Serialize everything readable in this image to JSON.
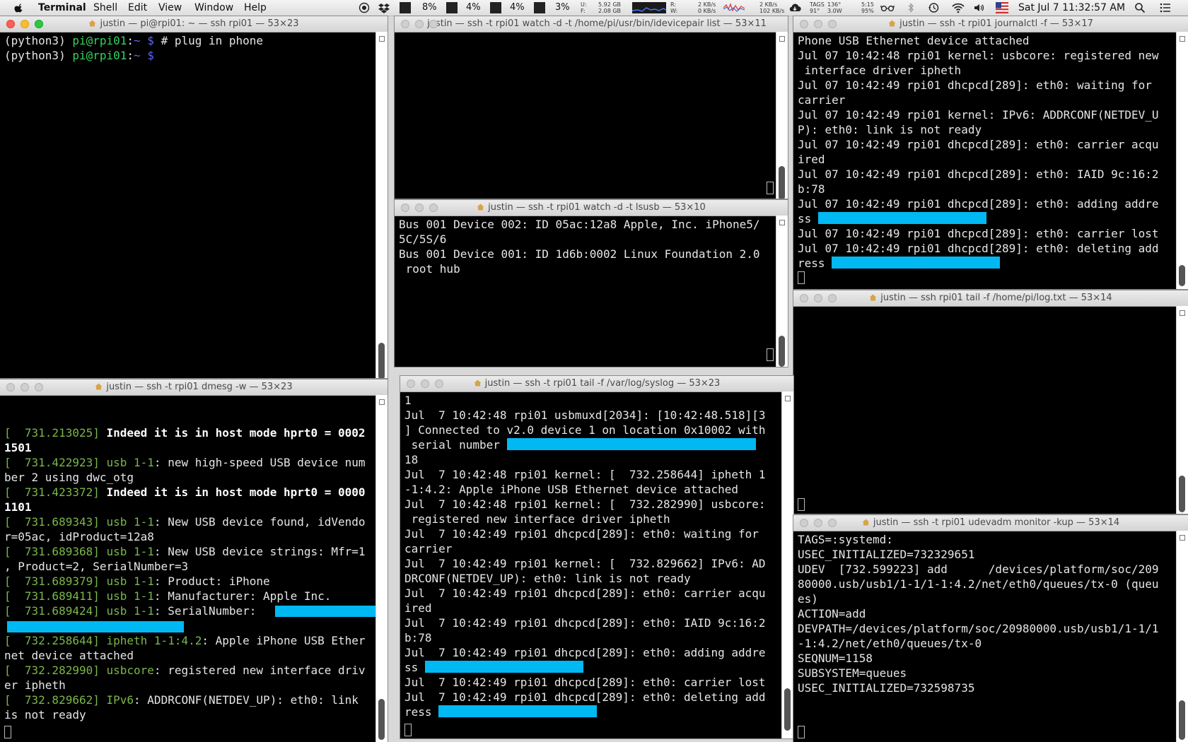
{
  "menubar": {
    "app": "Terminal",
    "menus": [
      "Shell",
      "Edit",
      "View",
      "Window",
      "Help"
    ],
    "cpu": [
      "8%",
      "4%",
      "4%",
      "3%"
    ],
    "mem_u": "U:",
    "mem_f": "F:",
    "mem_u_val": "5.92 GB",
    "mem_f_val": "2.08 GB",
    "disk_r": "R:",
    "disk_w": "W:",
    "disk_r_val": "2 KB/s",
    "disk_w_val": "0 KB/s",
    "net_up": "2 KB/s",
    "net_down": "102 KB/s",
    "sens1": "TAGS",
    "sens2": "91°",
    "sens3": "136°",
    "sens4": "3.0W",
    "bat1": "5:15",
    "bat2": "95%",
    "clock": "Sat Jul 7  11:32:57 AM"
  },
  "windows": {
    "w1": {
      "title": "justin — pi@rpi01: ~ — ssh rpi01 — 53×23",
      "prompt1_env": "(python3) ",
      "prompt1_user": "pi@rpi01",
      "prompt1_sep": ":",
      "prompt1_dir": "~",
      "prompt1_sym": " $",
      "prompt1_cmd": " # plug in phone",
      "prompt2_env": "(python3) ",
      "prompt2_user": "pi@rpi01",
      "prompt2_sep": ":",
      "prompt2_dir": "~",
      "prompt2_sym": " $"
    },
    "w2": {
      "title": "justin — ssh -t rpi01 watch -d -t /home/pi/usr/bin/idevicepair list — 53×11"
    },
    "w3": {
      "title": "justin — ssh -t rpi01 watch -d -t lsusb — 53×10",
      "lines": [
        "Bus 001 Device 002: ID 05ac:12a8 Apple, Inc. iPhone5/",
        "5C/5S/6",
        "Bus 001 Device 001: ID 1d6b:0002 Linux Foundation 2.0",
        " root hub"
      ]
    },
    "w4": {
      "title": "justin — ssh -t rpi01 journalctl -f — 53×17",
      "lines": [
        "Phone USB Ethernet device attached",
        "Jul 07 10:42:48 rpi01 kernel: usbcore: registered new",
        " interface driver ipheth",
        "Jul 07 10:42:49 rpi01 dhcpcd[289]: eth0: waiting for",
        "carrier",
        "Jul 07 10:42:49 rpi01 kernel: IPv6: ADDRCONF(NETDEV_U",
        "P): eth0: link is not ready",
        "Jul 07 10:42:49 rpi01 dhcpcd[289]: eth0: carrier acqu",
        "ired",
        "Jul 07 10:42:49 rpi01 dhcpcd[289]: eth0: IAID 9c:16:2",
        "b:78",
        "Jul 07 10:42:49 rpi01 dhcpcd[289]: eth0: adding addre",
        "ss ",
        "Jul 07 10:42:49 rpi01 dhcpcd[289]: eth0: carrier lost",
        "Jul 07 10:42:49 rpi01 dhcpcd[289]: eth0: deleting add",
        "ress "
      ]
    },
    "w5": {
      "title": "justin — ssh rpi01 tail -f /home/pi/log.txt — 53×14"
    },
    "w6": {
      "title": "justin — ssh -t rpi01 dmesg -w — 53×23",
      "lines": [
        {
          "ts": "[  731.213025]",
          "src": " ",
          "msg": "Indeed it is in host mode hprt0 = 0002",
          "bold": true
        },
        {
          "ts": "",
          "src": "",
          "msg": "1501",
          "bold": true
        },
        {
          "ts": "[  731.422923]",
          "src": " usb 1-1",
          "msg": ": new high-speed USB device num",
          "bold": false
        },
        {
          "ts": "",
          "src": "",
          "msg": "ber 2 using dwc_otg",
          "bold": false
        },
        {
          "ts": "[  731.423372]",
          "src": " ",
          "msg": "Indeed it is in host mode hprt0 = 0000",
          "bold": true
        },
        {
          "ts": "",
          "src": "",
          "msg": "1101",
          "bold": true
        },
        {
          "ts": "[  731.689343]",
          "src": " usb 1-1",
          "msg": ": New USB device found, idVendo",
          "bold": false
        },
        {
          "ts": "",
          "src": "",
          "msg": "r=05ac, idProduct=12a8",
          "bold": false
        },
        {
          "ts": "[  731.689368]",
          "src": " usb 1-1",
          "msg": ": New USB device strings: Mfr=1",
          "bold": false
        },
        {
          "ts": "",
          "src": "",
          "msg": ", Product=2, SerialNumber=3",
          "bold": false
        },
        {
          "ts": "[  731.689379]",
          "src": " usb 1-1",
          "msg": ": Product: iPhone",
          "bold": false
        },
        {
          "ts": "[  731.689411]",
          "src": " usb 1-1",
          "msg": ": Manufacturer: Apple Inc.",
          "bold": false
        },
        {
          "ts": "[  731.689424]",
          "src": " usb 1-1",
          "msg": ": SerialNumber: ",
          "bold": false
        },
        {
          "ts": "",
          "src": "",
          "msg": "",
          "bold": false
        },
        {
          "ts": "[  732.258644]",
          "src": " ipheth 1-1:4.2",
          "msg": ": Apple iPhone USB Ether",
          "bold": false
        },
        {
          "ts": "",
          "src": "",
          "msg": "net device attached",
          "bold": false
        },
        {
          "ts": "[  732.282990]",
          "src": " usbcore",
          "msg": ": registered new interface driv",
          "bold": false
        },
        {
          "ts": "",
          "src": "",
          "msg": "er ipheth",
          "bold": false
        },
        {
          "ts": "[  732.829662]",
          "src": " IPv6",
          "msg": ": ADDRCONF(NETDEV_UP): eth0: link",
          "bold": false
        },
        {
          "ts": "",
          "src": "",
          "msg": "is not ready",
          "bold": false
        }
      ]
    },
    "w7": {
      "title": "justin — ssh -t rpi01 tail -f /var/log/syslog — 53×23",
      "lines": [
        "1",
        "Jul  7 10:42:48 rpi01 usbmuxd[2034]: [10:42:48.518][3",
        "] Connected to v2.0 device 1 on location 0x10002 with",
        " serial number ",
        "18",
        "Jul  7 10:42:48 rpi01 kernel: [  732.258644] ipheth 1",
        "-1:4.2: Apple iPhone USB Ethernet device attached",
        "Jul  7 10:42:48 rpi01 kernel: [  732.282990] usbcore:",
        " registered new interface driver ipheth",
        "Jul  7 10:42:49 rpi01 dhcpcd[289]: eth0: waiting for",
        "carrier",
        "Jul  7 10:42:49 rpi01 kernel: [  732.829662] IPv6: AD",
        "DRCONF(NETDEV_UP): eth0: link is not ready",
        "Jul  7 10:42:49 rpi01 dhcpcd[289]: eth0: carrier acqu",
        "ired",
        "Jul  7 10:42:49 rpi01 dhcpcd[289]: eth0: IAID 9c:16:2",
        "b:78",
        "Jul  7 10:42:49 rpi01 dhcpcd[289]: eth0: adding addre",
        "ss ",
        "Jul  7 10:42:49 rpi01 dhcpcd[289]: eth0: carrier lost",
        "Jul  7 10:42:49 rpi01 dhcpcd[289]: eth0: deleting add",
        "ress "
      ]
    },
    "w8": {
      "title": "justin — ssh -t rpi01 udevadm monitor -kup — 53×14",
      "lines": [
        "TAGS=:systemd:",
        "USEC_INITIALIZED=732329651",
        "",
        "UDEV  [732.599223] add      /devices/platform/soc/209",
        "80000.usb/usb1/1-1/1-1:4.2/net/eth0/queues/tx-0 (queu",
        "es)",
        "ACTION=add",
        "DEVPATH=/devices/platform/soc/20980000.usb/usb1/1-1/1",
        "-1:4.2/net/eth0/queues/tx-0",
        "SEQNUM=1158",
        "SUBSYSTEM=queues",
        "USEC_INITIALIZED=732598735"
      ]
    }
  }
}
